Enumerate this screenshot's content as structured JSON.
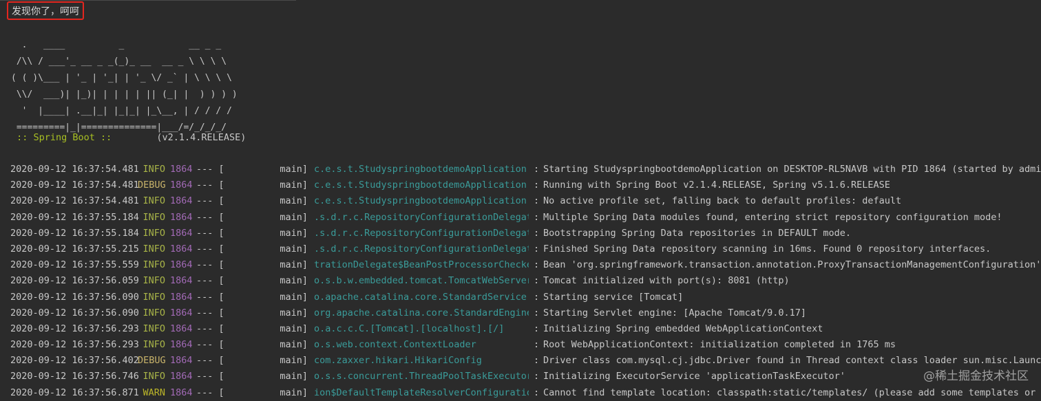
{
  "console": {
    "top_output_line": "发现你了，呵呵",
    "banner_lines": [
      "  .   ____          _            __ _ _",
      " /\\\\ / ___'_ __ _ _(_)_ __  __ _ \\ \\ \\ \\",
      "( ( )\\___ | '_ | '_| | '_ \\/ _` | \\ \\ \\ \\",
      " \\\\/  ___)| |_)| | | | | || (_| |  ) ) ) )",
      "  '  |____| .__|_| |_|_| |_\\__, | / / / /",
      " =========|_|==============|___/=/_/_/_/"
    ],
    "boot_prefix": " :: Spring Boot :: ",
    "boot_version": "       (v2.1.4.RELEASE)"
  },
  "log_rows": [
    {
      "time": "2020-09-12 16:37:54.481",
      "level": "INFO",
      "pid": "1864",
      "sep": "--- [",
      "thread": "main]",
      "logger": "c.e.s.t.StudyspringbootdemoApplication",
      "msg": "Starting StudyspringbootdemoApplication on DESKTOP-RL5NAVB with PID 1864 (started by admin in"
    },
    {
      "time": "2020-09-12 16:37:54.481",
      "level": "DEBUG",
      "pid": "1864",
      "sep": "--- [",
      "thread": "main]",
      "logger": "c.e.s.t.StudyspringbootdemoApplication",
      "msg": "Running with Spring Boot v2.1.4.RELEASE, Spring v5.1.6.RELEASE"
    },
    {
      "time": "2020-09-12 16:37:54.481",
      "level": "INFO",
      "pid": "1864",
      "sep": "--- [",
      "thread": "main]",
      "logger": "c.e.s.t.StudyspringbootdemoApplication",
      "msg": "No active profile set, falling back to default profiles: default"
    },
    {
      "time": "2020-09-12 16:37:55.184",
      "level": "INFO",
      "pid": "1864",
      "sep": "--- [",
      "thread": "main]",
      "logger": ".s.d.r.c.RepositoryConfigurationDelegate",
      "msg": "Multiple Spring Data modules found, entering strict repository configuration mode!"
    },
    {
      "time": "2020-09-12 16:37:55.184",
      "level": "INFO",
      "pid": "1864",
      "sep": "--- [",
      "thread": "main]",
      "logger": ".s.d.r.c.RepositoryConfigurationDelegate",
      "msg": "Bootstrapping Spring Data repositories in DEFAULT mode."
    },
    {
      "time": "2020-09-12 16:37:55.215",
      "level": "INFO",
      "pid": "1864",
      "sep": "--- [",
      "thread": "main]",
      "logger": ".s.d.r.c.RepositoryConfigurationDelegate",
      "msg": "Finished Spring Data repository scanning in 16ms. Found 0 repository interfaces."
    },
    {
      "time": "2020-09-12 16:37:55.559",
      "level": "INFO",
      "pid": "1864",
      "sep": "--- [",
      "thread": "main]",
      "logger": "trationDelegate$BeanPostProcessorChecker",
      "msg": "Bean 'org.springframework.transaction.annotation.ProxyTransactionManagementConfiguration' of"
    },
    {
      "time": "2020-09-12 16:37:56.059",
      "level": "INFO",
      "pid": "1864",
      "sep": "--- [",
      "thread": "main]",
      "logger": "o.s.b.w.embedded.tomcat.TomcatWebServer",
      "msg": "Tomcat initialized with port(s): 8081 (http)"
    },
    {
      "time": "2020-09-12 16:37:56.090",
      "level": "INFO",
      "pid": "1864",
      "sep": "--- [",
      "thread": "main]",
      "logger": "o.apache.catalina.core.StandardService",
      "msg": "Starting service [Tomcat]"
    },
    {
      "time": "2020-09-12 16:37:56.090",
      "level": "INFO",
      "pid": "1864",
      "sep": "--- [",
      "thread": "main]",
      "logger": "org.apache.catalina.core.StandardEngine",
      "msg": "Starting Servlet engine: [Apache Tomcat/9.0.17]"
    },
    {
      "time": "2020-09-12 16:37:56.293",
      "level": "INFO",
      "pid": "1864",
      "sep": "--- [",
      "thread": "main]",
      "logger": "o.a.c.c.C.[Tomcat].[localhost].[/]",
      "msg": "Initializing Spring embedded WebApplicationContext"
    },
    {
      "time": "2020-09-12 16:37:56.293",
      "level": "INFO",
      "pid": "1864",
      "sep": "--- [",
      "thread": "main]",
      "logger": "o.s.web.context.ContextLoader",
      "msg": "Root WebApplicationContext: initialization completed in 1765 ms"
    },
    {
      "time": "2020-09-12 16:37:56.402",
      "level": "DEBUG",
      "pid": "1864",
      "sep": "--- [",
      "thread": "main]",
      "logger": "com.zaxxer.hikari.HikariConfig",
      "msg": "Driver class com.mysql.cj.jdbc.Driver found in Thread context class loader sun.misc.Launcher$a"
    },
    {
      "time": "2020-09-12 16:37:56.746",
      "level": "INFO",
      "pid": "1864",
      "sep": "--- [",
      "thread": "main]",
      "logger": "o.s.s.concurrent.ThreadPoolTaskExecutor",
      "msg": "Initializing ExecutorService 'applicationTaskExecutor'"
    },
    {
      "time": "2020-09-12 16:37:56.871",
      "level": "WARN",
      "pid": "1864",
      "sep": "--- [",
      "thread": "main]",
      "logger": "ion$DefaultTemplateResolverConfiguration",
      "msg": "Cannot find template location: classpath:static/templates/ (please add some templates or check"
    }
  ],
  "watermark": "@稀土掘金技术社区",
  "colors": {
    "background": "#2b2b2b",
    "highlight_border": "#e4261f",
    "info": "#a9b548",
    "debug": "#c8b36a",
    "warn": "#bbb529",
    "pid": "#a26ab6",
    "logger": "#3a9c9a",
    "boot": "#a8c023"
  }
}
